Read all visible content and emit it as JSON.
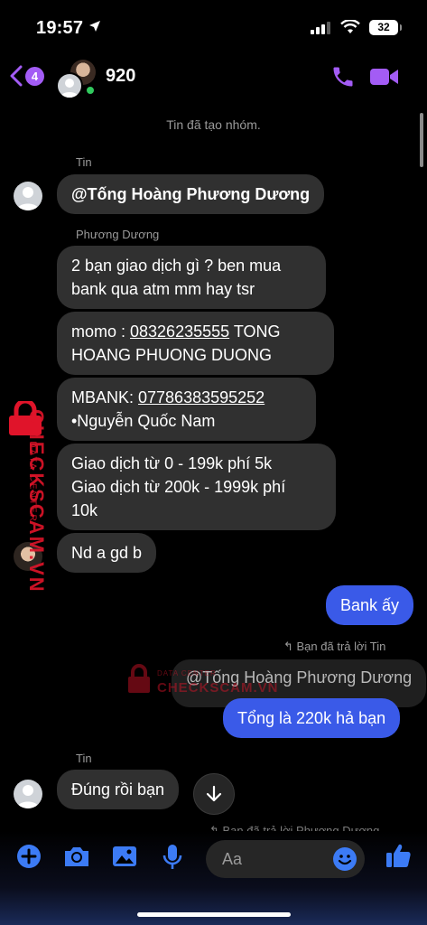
{
  "status": {
    "time": "19:57",
    "battery": "32"
  },
  "header": {
    "back_badge": "4",
    "title": "920"
  },
  "system_message": "Tin đã tạo nhóm.",
  "messages": {
    "sender_tin": "Tin",
    "mention": "@Tống Hoàng Phương Dương",
    "sender_duong": "Phương Dương",
    "m1_line1": "2 bạn giao dịch gì ? ben mua",
    "m1_line2": "bank qua atm mm hay tsr",
    "m2_prefix": "momo : ",
    "m2_number": "08326235555",
    "m2_suffix": " TONG",
    "m2_line2": "HOANG PHUONG DUONG",
    "m3_prefix": "MBANK: ",
    "m3_number": "07786383595252",
    "m3_line2": "•Nguyễn Quốc Nam",
    "m4_line1": "Giao dịch từ 0 - 199k phí 5k",
    "m4_line2": "Giao dịch từ 200k - 1999k phí",
    "m4_line3": "10k",
    "m5": "Nd a gd b",
    "me1": "Bank ấy",
    "reply_label_tin": "Bạn đã trả lời Tin",
    "quoted": "@Tống Hoàng Phương Dương",
    "me2": "Tổng là 220k hả bạn",
    "sender_tin2": "Tin",
    "m6": "Đúng rồi bạn",
    "reply_label_duong": "Bạn đã trả lời Phương Dương"
  },
  "watermark": {
    "brand": "CHECKSCAM.VN",
    "sub": "DATA CENTER"
  },
  "composer": {
    "placeholder": "Aa"
  },
  "colors": {
    "accent": "#a35cf5",
    "my_bubble": "#3a5ae8",
    "their_bubble": "#303030",
    "composer_icon": "#3c7bf5"
  }
}
